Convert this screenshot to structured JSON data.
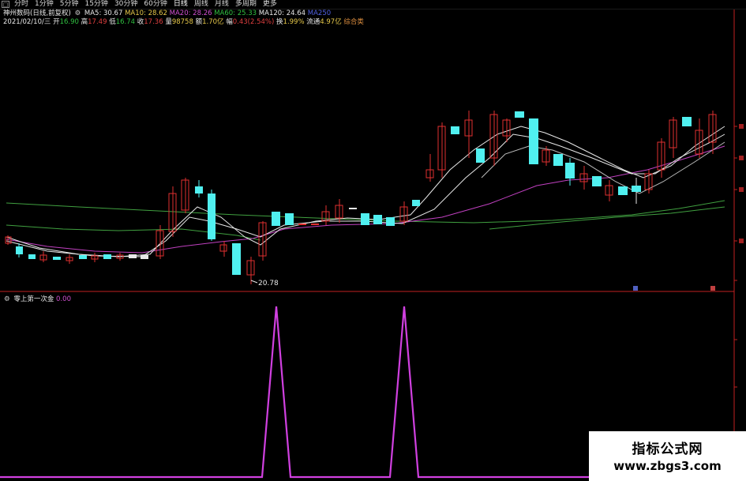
{
  "toolbar": {
    "tabs": [
      "分时",
      "1分钟",
      "5分钟",
      "15分钟",
      "30分钟",
      "60分钟",
      "日线",
      "周线",
      "月线",
      "多周期",
      "更多"
    ]
  },
  "header": {
    "stock_name": "神州数码",
    "period_mode": "(日线,前复权)",
    "ma5": "MA5: 30.67",
    "ma10": "MA10: 28.62",
    "ma20": "MA20: 28.26",
    "ma60": "MA60: 25.33",
    "ma120": "MA120: 24.64",
    "ma250": "MA250",
    "date": "2021/02/10/三",
    "open_label": "开",
    "open": "16.90",
    "high_label": "高",
    "high": "17.49",
    "low_label": "低",
    "low": "16.74",
    "close_label": "收",
    "close": "17.36",
    "volume_label": "量",
    "volume": "98758",
    "amount_label": "额",
    "amount": "1.70亿",
    "change_label": "幅",
    "change": "0.43(2.54%)",
    "turnover_label": "换",
    "turnover": "1.99%",
    "float_label": "流通",
    "float": "4.97亿",
    "category": "综合类"
  },
  "price_chart": {
    "low_annotation": "20.78"
  },
  "indicator": {
    "name": "零上第一次金",
    "value": "0.00"
  },
  "watermark": {
    "line1": "指标公式网",
    "line2": "www.zbgs3.com"
  },
  "colors": {
    "background": "#000000",
    "up_candle": "#e03030",
    "down_candle": "#50f0f0",
    "ma_white": "#e8e8e8",
    "ma_magenta": "#c040c0",
    "ma_green": "#40a040",
    "indicator_line": "#d040e0"
  }
}
